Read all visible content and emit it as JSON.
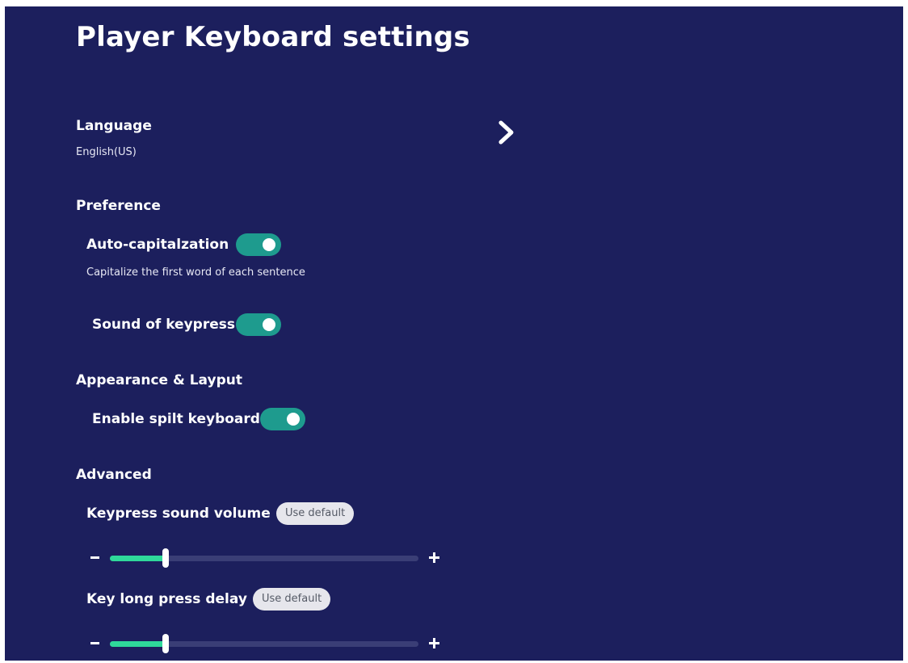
{
  "page": {
    "title": "Player Keyboard settings"
  },
  "language": {
    "heading": "Language",
    "value": "English(US)"
  },
  "preference": {
    "heading": "Preference",
    "auto_cap": {
      "label": "Auto-capitalzation",
      "description": "Capitalize the first word of each sentence",
      "enabled": true
    },
    "keypress_sound": {
      "label": "Sound of keypress",
      "enabled": true
    }
  },
  "appearance": {
    "heading": "Appearance & Layput",
    "split_keyboard": {
      "label": "Enable spilt keyboard",
      "enabled": true
    }
  },
  "advanced": {
    "heading": "Advanced",
    "volume": {
      "label": "Keypress sound volume",
      "default_label": "Use default",
      "level_fraction": 0.18
    },
    "delay": {
      "label": "Key long press delay",
      "default_label": "Use default",
      "level_fraction": 0.18
    }
  },
  "colors": {
    "background": "#1c1f5d",
    "toggle_on": "#1e9b8e",
    "slider_fill": "#2fd99a",
    "slider_track": "#3a3e76"
  },
  "icons": {
    "language_arrow": "chevron-right-icon",
    "decrease": "minus-icon",
    "increase": "plus-icon"
  }
}
